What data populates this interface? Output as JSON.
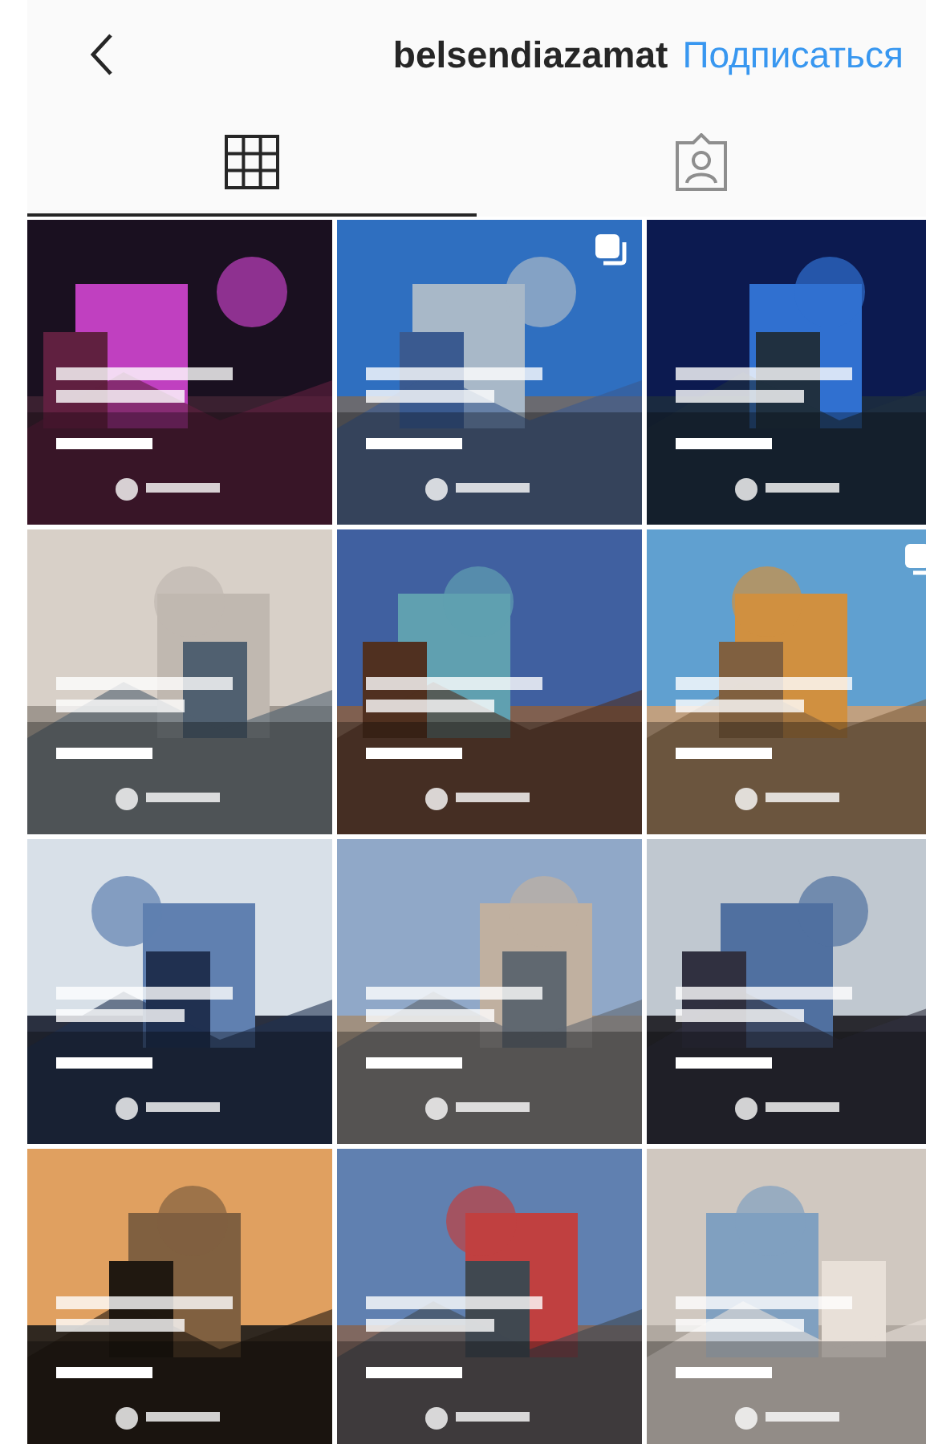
{
  "header": {
    "username": "belsendiazamat",
    "follow_button": "Подписаться"
  },
  "tabs": [
    {
      "kind": "grid",
      "selected": true
    },
    {
      "kind": "tagged",
      "selected": false
    }
  ],
  "posts": [
    {
      "kind": "picture",
      "carousel": false
    },
    {
      "kind": "picture",
      "carousel": true
    },
    {
      "kind": "picture",
      "carousel": false
    },
    {
      "kind": "picture",
      "carousel": false
    },
    {
      "kind": "picture",
      "carousel": false
    },
    {
      "kind": "picture",
      "carousel": true
    },
    {
      "kind": "picture",
      "carousel": false
    },
    {
      "kind": "picture",
      "carousel": false
    },
    {
      "kind": "picture",
      "carousel": false
    },
    {
      "kind": "picture",
      "carousel": false
    },
    {
      "kind": "picture",
      "carousel": false
    },
    {
      "kind": "picture",
      "carousel": false
    }
  ]
}
